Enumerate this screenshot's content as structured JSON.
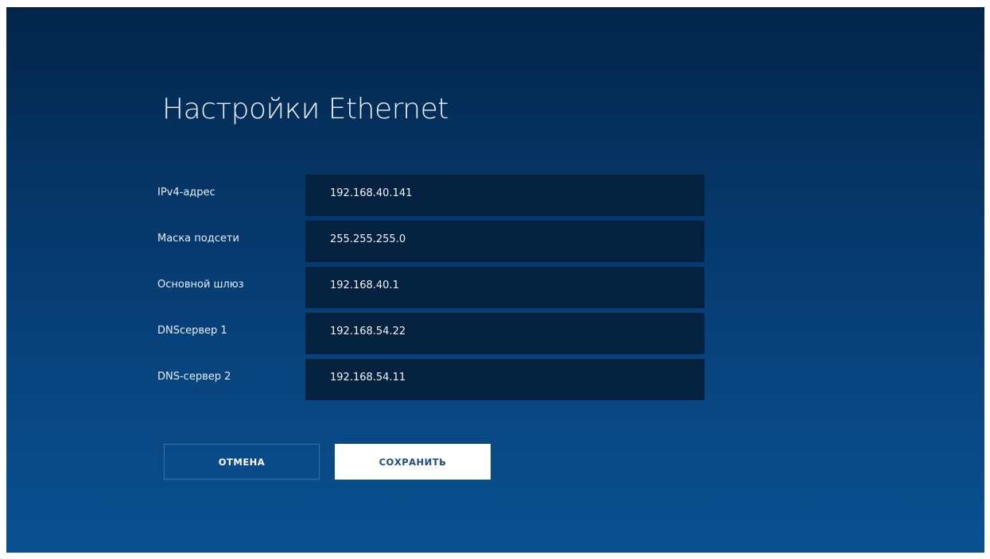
{
  "page": {
    "title": "Настройки Ethernet"
  },
  "fields": [
    {
      "label": "IPv4-адрес",
      "value": "192.168.40.141"
    },
    {
      "label": "Маска подсети",
      "value": "255.255.255.0"
    },
    {
      "label": "Основной шлюз",
      "value": "192.168.40.1"
    },
    {
      "label": "DNSсервер 1",
      "value": "192.168.54.22"
    },
    {
      "label": "DNS-сервер 2",
      "value": "192.168.54.11"
    }
  ],
  "buttons": {
    "cancel_label": "ОТМЕНА",
    "save_label": "СОХРАНИТЬ"
  },
  "colors": {
    "background_top": "#03254a",
    "background_bottom": "#0a5192",
    "field_background": "#04213f",
    "save_text": "#1d4a82"
  }
}
